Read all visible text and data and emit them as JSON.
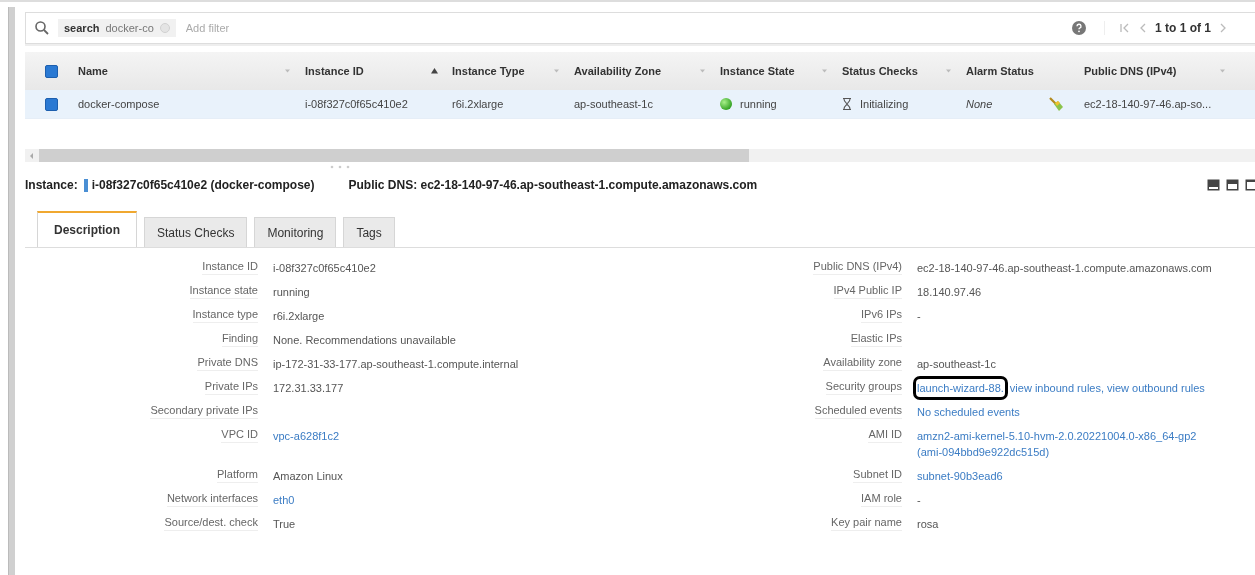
{
  "search": {
    "token_key": "search",
    "token_value": "docker-co",
    "placeholder": "Add filter"
  },
  "pagination": {
    "range": "1 to 1 of 1"
  },
  "table": {
    "select_all": {
      "checked": true
    },
    "columns": [
      {
        "label": "Name",
        "sorted": false
      },
      {
        "label": "Instance ID",
        "sorted": true
      },
      {
        "label": "Instance Type",
        "sorted": false
      },
      {
        "label": "Availability Zone",
        "sorted": false
      },
      {
        "label": "Instance State",
        "sorted": false
      },
      {
        "label": "Status Checks",
        "sorted": false
      },
      {
        "label": "Alarm Status"
      },
      {
        "label": "Public DNS (IPv4)",
        "sorted": false
      }
    ],
    "rows": [
      {
        "selected": true,
        "name": "docker-compose",
        "instance_id": "i-08f327c0f65c410e2",
        "instance_type": "r6i.2xlarge",
        "zone": "ap-southeast-1c",
        "state": "running",
        "status_checks": "Initializing",
        "alarm_status": "None",
        "public_dns": "ec2-18-140-97-46.ap-so..."
      }
    ]
  },
  "heading": {
    "label": "Instance:",
    "instance": "i-08f327c0f65c410e2 (docker-compose)",
    "dns": "Public DNS: ec2-18-140-97-46.ap-southeast-1.compute.amazonaws.com"
  },
  "tabs": [
    {
      "label": "Description",
      "selected": true
    },
    {
      "label": "Status Checks",
      "selected": false
    },
    {
      "label": "Monitoring",
      "selected": false
    },
    {
      "label": "Tags",
      "selected": false
    }
  ],
  "details": [
    {
      "left": {
        "label": "Instance ID",
        "value": [
          {
            "text": "i-08f327c0f65c410e2",
            "kind": "text"
          }
        ]
      },
      "right": {
        "label": "Public DNS (IPv4)",
        "value": [
          {
            "text": "ec2-18-140-97-46.ap-southeast-1.compute.amazonaws.com",
            "kind": "text"
          }
        ]
      }
    },
    {
      "left": {
        "label": "Instance state",
        "value": [
          {
            "text": "running",
            "kind": "text"
          }
        ]
      },
      "right": {
        "label": "IPv4 Public IP",
        "value": [
          {
            "text": "18.140.97.46",
            "kind": "text"
          }
        ]
      }
    },
    {
      "left": {
        "label": "Instance type",
        "value": [
          {
            "text": "r6i.2xlarge",
            "kind": "text"
          }
        ]
      },
      "right": {
        "label": "IPv6 IPs",
        "value": [
          {
            "text": "-",
            "kind": "text"
          }
        ]
      }
    },
    {
      "left": {
        "label": "Finding",
        "value": [
          {
            "text": "None. Recommendations unavailable",
            "kind": "text"
          }
        ]
      },
      "right": {
        "label": "Elastic IPs"
      }
    },
    {
      "left": {
        "label": "Private DNS",
        "value": [
          {
            "text": "ip-172-31-33-177.ap-southeast-1.compute.internal",
            "kind": "text"
          }
        ]
      },
      "right": {
        "label": "Availability zone",
        "value": [
          {
            "text": "ap-southeast-1c",
            "kind": "text"
          }
        ]
      }
    },
    {
      "left": {
        "label": "Private IPs",
        "value": [
          {
            "text": "172.31.33.177",
            "kind": "text"
          }
        ]
      },
      "right": {
        "label": "Security groups",
        "value": [
          {
            "text": "launch-wizard-88.",
            "kind": "link",
            "highlighted": true
          },
          {
            "text": "view inbound rules,",
            "kind": "link",
            "highlighted": false
          },
          {
            "text": "view outbound rules",
            "kind": "link",
            "highlighted": false
          }
        ]
      }
    },
    {
      "left": {
        "label": "Secondary private IPs"
      },
      "right": {
        "label": "Scheduled events",
        "value": [
          {
            "text": "No scheduled events",
            "kind": "link"
          }
        ]
      }
    },
    {
      "left": {
        "label": "VPC ID",
        "value": [
          {
            "text": "vpc-a628f1c2",
            "kind": "link"
          }
        ]
      },
      "right": {
        "label": "AMI ID",
        "value": [
          {
            "text": "amzn2-ami-kernel-5.10-hvm-2.0.20221004.0-x86_64-gp2",
            "kind": "link"
          },
          {
            "text": "(ami-094bbd9e922dc515d)",
            "kind": "link"
          }
        ]
      }
    },
    {
      "left": {
        "label": "Platform",
        "value": [
          {
            "text": "Amazon Linux",
            "kind": "text"
          }
        ]
      },
      "right": {
        "label": "Subnet ID",
        "value": [
          {
            "text": "subnet-90b3ead6",
            "kind": "link"
          }
        ]
      }
    },
    {
      "left": {
        "label": "Network interfaces",
        "value": [
          {
            "text": "eth0",
            "kind": "link"
          }
        ]
      },
      "right": {
        "label": "IAM role",
        "value": [
          {
            "text": "-",
            "kind": "text"
          }
        ]
      }
    },
    {
      "left": {
        "label": "Source/dest. check",
        "value": [
          {
            "text": "True",
            "kind": "text"
          }
        ]
      },
      "right": {
        "label": "Key pair name",
        "value": [
          {
            "text": "rosa",
            "kind": "text"
          }
        ]
      }
    }
  ]
}
